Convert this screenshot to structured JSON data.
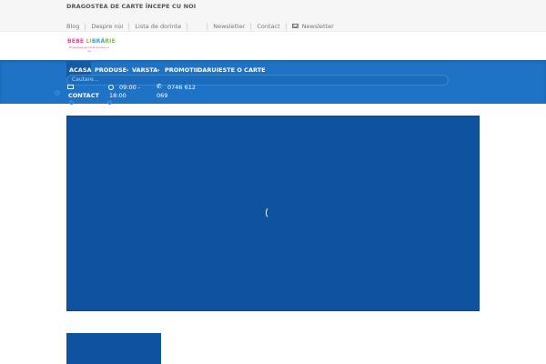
{
  "topbar": {
    "tagline": "DRAGOSTEA DE CARTE ÎNCEPE CU NOI",
    "links": [
      "Blog",
      "Despre noi",
      "Lista de dorinte",
      "Newsletter",
      "Contact"
    ],
    "newsletter_label": "Newsletter"
  },
  "logo": {
    "parts": [
      "BEBE ",
      "LI",
      "BRĂ",
      "RIE"
    ],
    "subtitle": "Dragostea de carte incepe cu noi"
  },
  "nav": {
    "items": [
      "ACASA",
      "PRODUSE",
      "VARSTA",
      "PROMOTII",
      "DARUIESTE O CARTE"
    ],
    "caret": "▾"
  },
  "search": {
    "placeholder": "Cautare..."
  },
  "contact": {
    "contact_label": "CONTACT",
    "hours_line1": "09:00 -",
    "hours_line2": "18:00",
    "phone_line1": "0746 612",
    "phone_line2": "069"
  },
  "hero": {
    "loader_glyph": "("
  },
  "colors": {
    "nav_bg": "#1f73c6",
    "nav_active": "#155aa3",
    "hero_bg": "#0f52a0"
  },
  "icons": {
    "mail": "envelope-icon",
    "clock": "clock-icon",
    "phone": "phone-icon",
    "search": "search-icon"
  }
}
